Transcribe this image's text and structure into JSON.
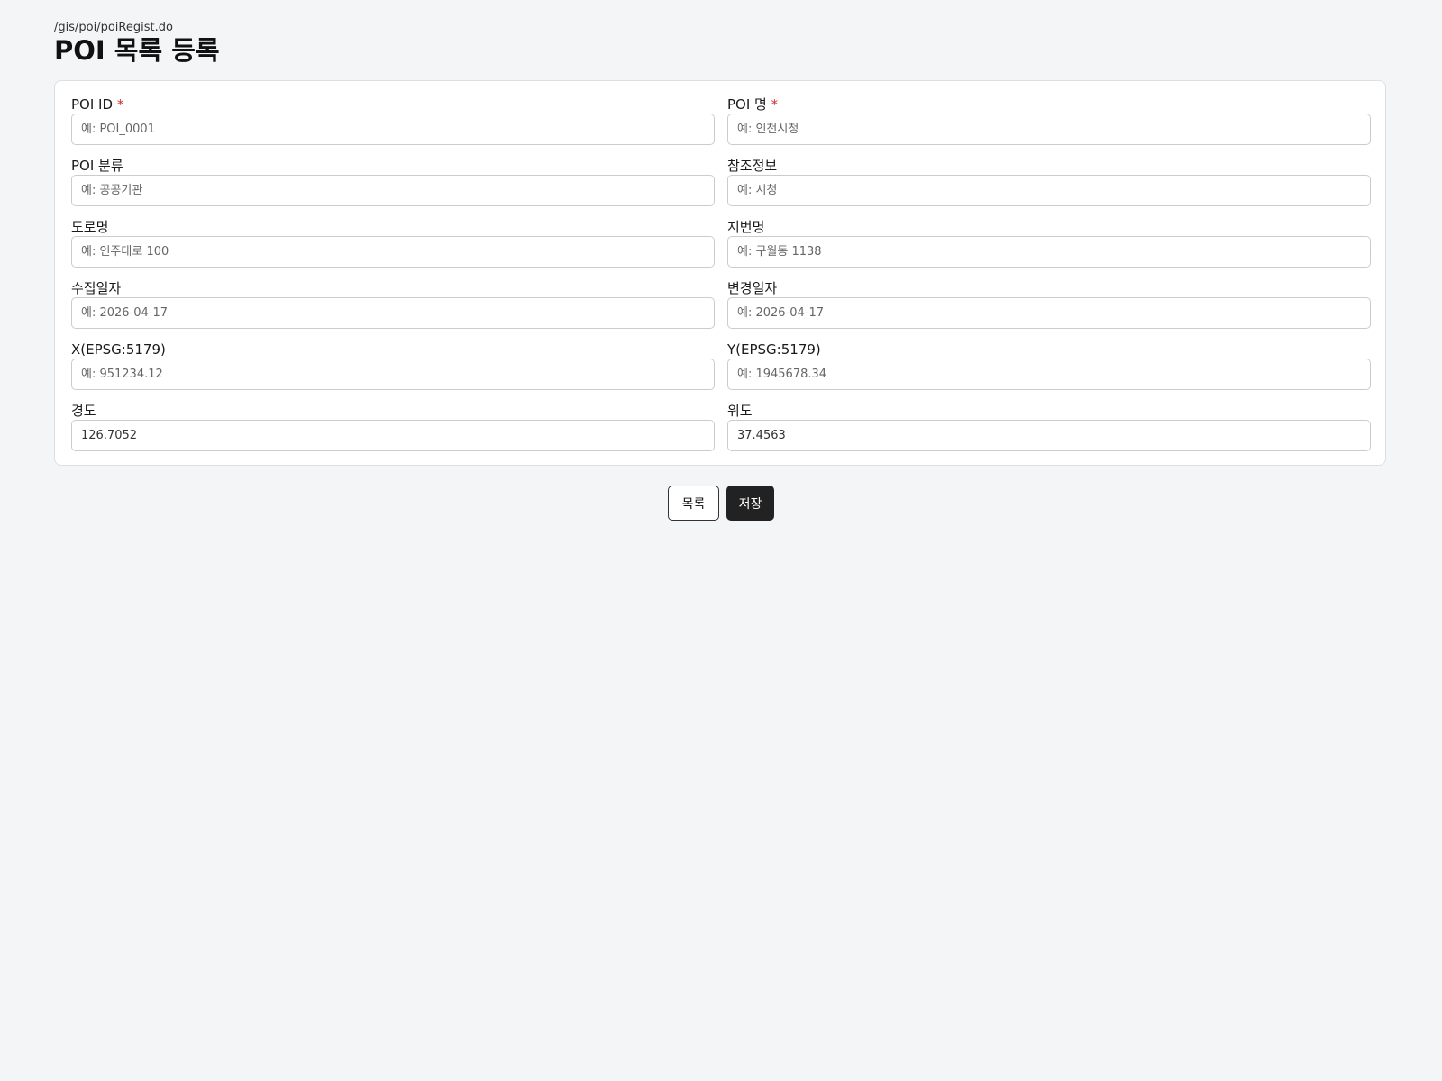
{
  "header": {
    "breadcrumb": "/gis/poi/poiRegist.do",
    "title": "POI 목록 등록"
  },
  "form": {
    "required_mark": "*",
    "fields": [
      {
        "label": "POI ID",
        "required": true,
        "placeholder": "예: POI_0001",
        "value": ""
      },
      {
        "label": "POI 명",
        "required": true,
        "placeholder": "예: 인천시청",
        "value": ""
      },
      {
        "label": "POI 분류",
        "required": false,
        "placeholder": "예: 공공기관",
        "value": ""
      },
      {
        "label": "참조정보",
        "required": false,
        "placeholder": "예: 시청",
        "value": ""
      },
      {
        "label": "도로명",
        "required": false,
        "placeholder": "예: 인주대로 100",
        "value": ""
      },
      {
        "label": "지번명",
        "required": false,
        "placeholder": "예: 구월동 1138",
        "value": ""
      },
      {
        "label": "수집일자",
        "required": false,
        "placeholder": "예: 2026-04-17",
        "value": ""
      },
      {
        "label": "변경일자",
        "required": false,
        "placeholder": "예: 2026-04-17",
        "value": ""
      },
      {
        "label": "X(EPSG:5179)",
        "required": false,
        "placeholder": "예: 951234.12",
        "value": ""
      },
      {
        "label": "Y(EPSG:5179)",
        "required": false,
        "placeholder": "예: 1945678.34",
        "value": ""
      },
      {
        "label": "경도",
        "required": false,
        "placeholder": "",
        "value": "126.7052"
      },
      {
        "label": "위도",
        "required": false,
        "placeholder": "",
        "value": "37.4563"
      }
    ]
  },
  "actions": {
    "list_label": "목록",
    "save_label": "저장"
  },
  "colors": {
    "background": "#f4f5f7",
    "required": "#d32f2f",
    "primary_button": "#222222"
  }
}
